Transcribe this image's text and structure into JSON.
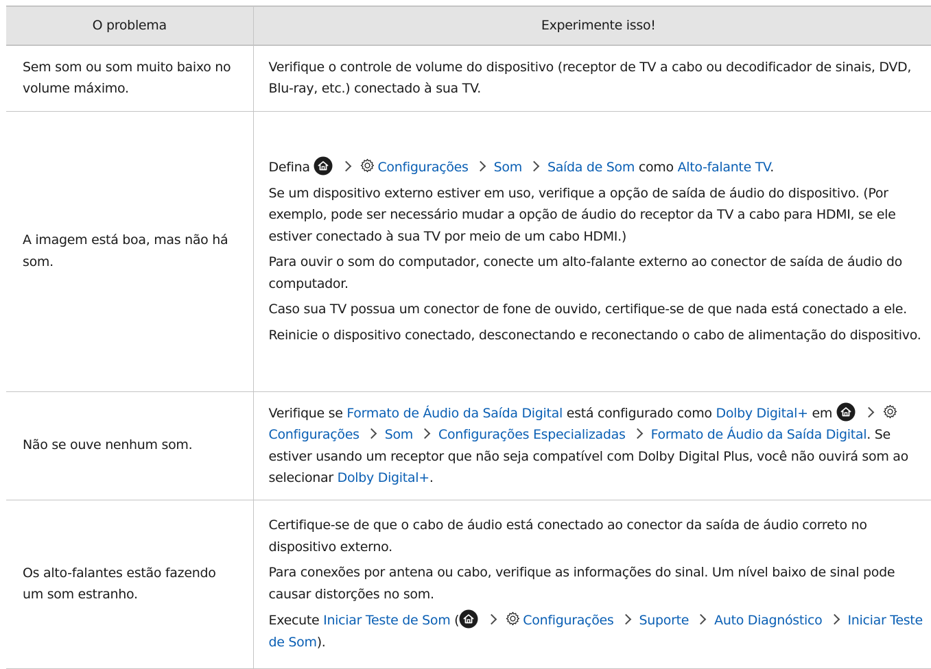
{
  "headers": {
    "problem": "O problema",
    "solution": "Experimente isso!"
  },
  "rows": [
    {
      "problem": "Sem som ou som muito baixo no volume máximo.",
      "p1": "Verifique o controle de volume do dispositivo (receptor de TV a cabo ou decodificador de sinais, DVD, Blu-ray, etc.) conectado à sua TV."
    },
    {
      "problem": "A imagem está boa, mas não há som.",
      "path": {
        "prefix": "Defina",
        "settings": "Configurações",
        "sound": "Som",
        "sound_output": "Saída de Som",
        "as": "como",
        "speaker": "Alto-falante TV",
        "end": "."
      },
      "p2": "Se um dispositivo externo estiver em uso, verifique a opção de saída de áudio do dispositivo. (Por exemplo, pode ser necessário mudar a opção de áudio do receptor da TV a cabo para HDMI, se ele estiver conectado à sua TV por meio de um cabo HDMI.)",
      "p3": "Para ouvir o som do computador, conecte um alto-falante externo ao conector de saída de áudio do computador.",
      "p4": "Caso sua TV possua um conector de fone de ouvido, certifique-se de que nada está conectado a ele.",
      "p5": "Reinicie o dispositivo conectado, desconectando e reconectando o cabo de alimentação do dispositivo."
    },
    {
      "problem": "Não se ouve nenhum som.",
      "t1": "Verifique se",
      "format": "Formato de Áudio da Saída Digital",
      "t2": "está configurado como",
      "dolby": "Dolby Digital+",
      "t3": "em",
      "settings": "Configurações",
      "sound": "Som",
      "expert": "Configurações Especializadas",
      "t4": ". Se estiver usando um receptor que não seja compatível com Dolby Digital Plus, você não ouvirá som ao selecionar",
      "t5": "."
    },
    {
      "problem": "Os alto-falantes estão fazendo um som estranho.",
      "p1": "Certifique-se de que o cabo de áudio está conectado ao conector da saída de áudio correto no dispositivo externo.",
      "p2": "Para conexões por antena ou cabo, verifique as informações do sinal. Um nível baixo de sinal pode causar distorções no som.",
      "exec": "Execute",
      "test": "Iniciar Teste de Som",
      "open": "(",
      "settings": "Configurações",
      "support": "Suporte",
      "diag": "Auto Diagnóstico",
      "close": ")."
    }
  ]
}
